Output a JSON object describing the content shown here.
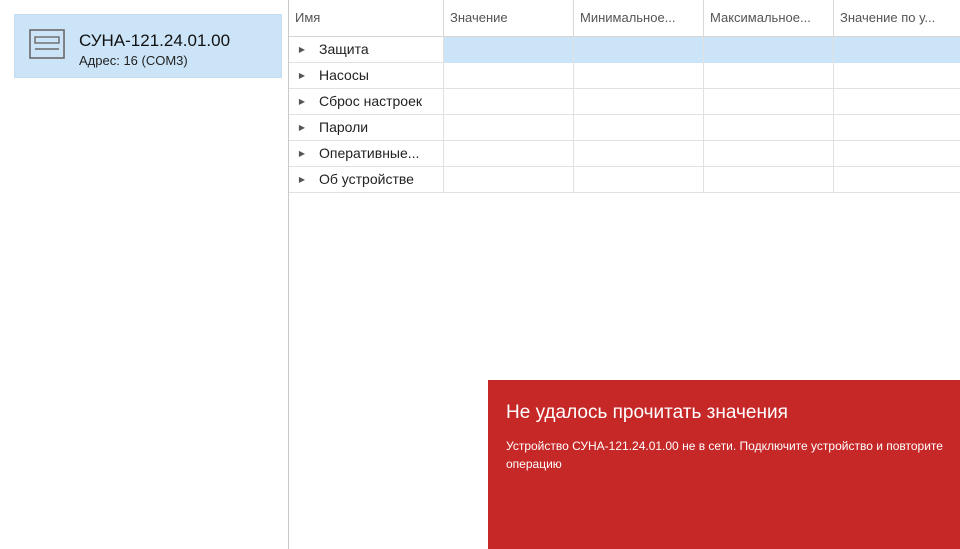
{
  "device_panel": {
    "device": {
      "icon": "device-icon",
      "name": "СУНА-121.24.01.00",
      "address": "Адрес: 16 (COM3)"
    }
  },
  "grid": {
    "columns": [
      "Имя",
      "Значение",
      "Минимальное...",
      "Максимальное...",
      "Значение по у..."
    ],
    "rows": [
      {
        "label": "Защита",
        "selected": true
      },
      {
        "label": "Насосы",
        "selected": false
      },
      {
        "label": "Сброс настроек",
        "selected": false
      },
      {
        "label": "Пароли",
        "selected": false
      },
      {
        "label": "Оперативные...",
        "selected": false
      },
      {
        "label": "Об устройстве",
        "selected": false
      }
    ]
  },
  "error": {
    "title": "Не удалось прочитать значения",
    "message": "Устройство СУНА-121.24.01.00  не в сети. Подключите устройство и повторите операцию"
  },
  "colors": {
    "selection": "#cce4f7",
    "error_background": "#c62828"
  }
}
